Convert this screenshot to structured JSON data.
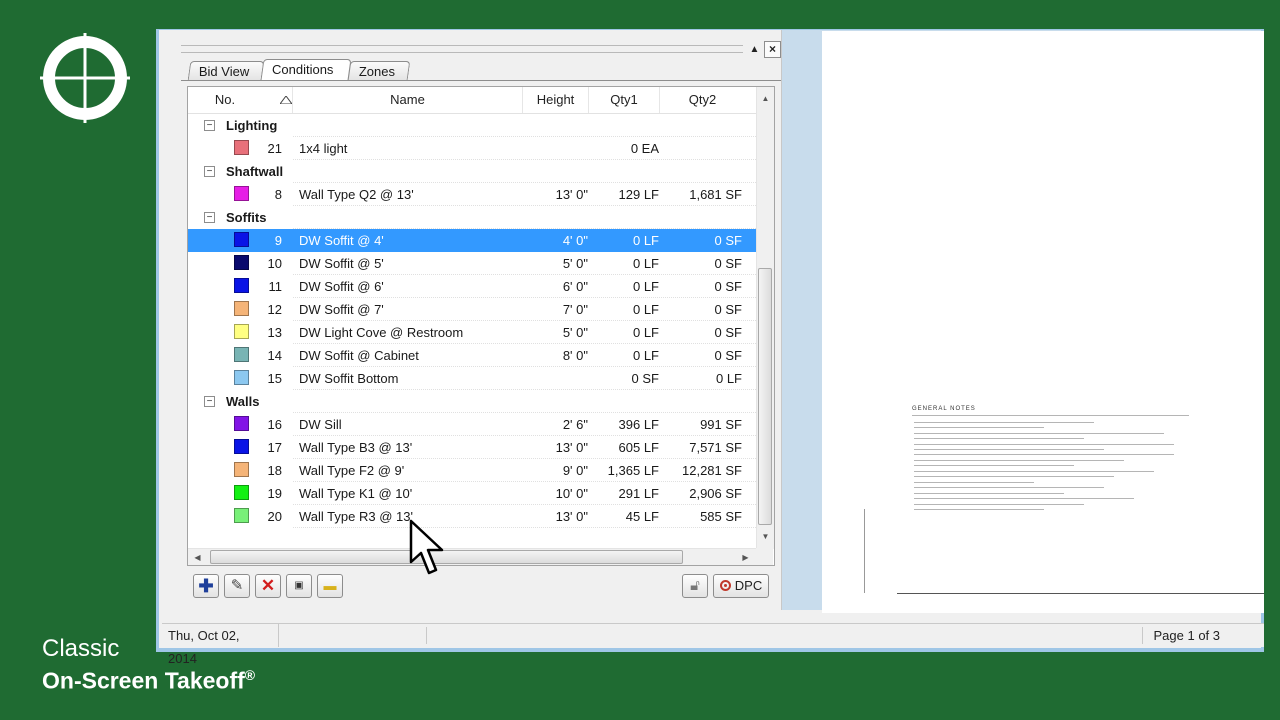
{
  "brand": {
    "line1": "Classic",
    "line2": "On-Screen Takeoff",
    "mark": "®"
  },
  "pane": {
    "tabs": [
      {
        "label": "Bid View"
      },
      {
        "label": "Conditions"
      },
      {
        "label": "Zones"
      }
    ],
    "active_tab": "Conditions",
    "columns": {
      "no": "No.",
      "name": "Name",
      "height": "Height",
      "qty1": "Qty1",
      "qty2": "Qty2"
    },
    "sort": "ascending",
    "groups": [
      {
        "label": "Lighting",
        "toggle": "−",
        "rows": [
          {
            "color": "#e8707a",
            "no": "21",
            "name": "1x4 light",
            "height": "",
            "qty1": "0 EA",
            "qty2": ""
          }
        ]
      },
      {
        "label": "Shaftwall",
        "toggle": "−",
        "rows": [
          {
            "color": "#e61ee6",
            "no": "8",
            "name": "Wall Type Q2 @ 13'",
            "height": "13' 0\"",
            "qty1": "129 LF",
            "qty2": "1,681 SF"
          }
        ]
      },
      {
        "label": "Soffits",
        "toggle": "−",
        "rows": [
          {
            "color": "#0a14e6",
            "no": "9",
            "name": "DW Soffit @ 4'",
            "height": "4' 0\"",
            "qty1": "0 LF",
            "qty2": "0 SF",
            "selected": true
          },
          {
            "color": "#0a0a6e",
            "no": "10",
            "name": "DW Soffit @ 5'",
            "height": "5' 0\"",
            "qty1": "0 LF",
            "qty2": "0 SF"
          },
          {
            "color": "#0a14e6",
            "no": "11",
            "name": "DW Soffit @ 6'",
            "height": "6' 0\"",
            "qty1": "0 LF",
            "qty2": "0 SF"
          },
          {
            "color": "#f5b478",
            "no": "12",
            "name": "DW Soffit @ 7'",
            "height": "7' 0\"",
            "qty1": "0 LF",
            "qty2": "0 SF"
          },
          {
            "color": "#ffff82",
            "no": "13",
            "name": "DW Light Cove @ Restroom",
            "height": "5' 0\"",
            "qty1": "0 LF",
            "qty2": "0 SF"
          },
          {
            "color": "#78b4b4",
            "no": "14",
            "name": "DW Soffit @ Cabinet",
            "height": "8' 0\"",
            "qty1": "0 LF",
            "qty2": "0 SF"
          },
          {
            "color": "#8cc8f0",
            "no": "15",
            "name": "DW Soffit Bottom",
            "height": "",
            "qty1": "0 SF",
            "qty2": "0 LF"
          }
        ]
      },
      {
        "label": "Walls",
        "toggle": "−",
        "rows": [
          {
            "color": "#8214e6",
            "no": "16",
            "name": "DW Sill",
            "height": "2' 6\"",
            "qty1": "396 LF",
            "qty2": "991 SF"
          },
          {
            "color": "#0a14e6",
            "no": "17",
            "name": "Wall Type B3 @ 13'",
            "height": "13' 0\"",
            "qty1": "605 LF",
            "qty2": "7,571 SF"
          },
          {
            "color": "#f5b478",
            "no": "18",
            "name": "Wall Type F2 @ 9'",
            "height": "9' 0\"",
            "qty1": "1,365 LF",
            "qty2": "12,281 SF"
          },
          {
            "color": "#14f014",
            "no": "19",
            "name": "Wall Type K1 @ 10'",
            "height": "10' 0\"",
            "qty1": "291 LF",
            "qty2": "2,906 SF"
          },
          {
            "color": "#78f078",
            "no": "20",
            "name": "Wall Type R3 @ 13'",
            "height": "13' 0\"",
            "qty1": "45 LF",
            "qty2": "585 SF"
          }
        ]
      }
    ],
    "toolbar": {
      "dpc_label": "DPC"
    },
    "scroll_arrows": {
      "up": "▲",
      "down": "▼",
      "left": "◀",
      "right": "▶"
    }
  },
  "drawing": {
    "notes_title": "GENERAL NOTES"
  },
  "status": {
    "date": "Thu, Oct 02, 2014",
    "page": "Page 1 of 3"
  },
  "colors": {
    "background": "#1f6b32",
    "selection": "#3399ff",
    "frame": "#9fc6e6"
  }
}
